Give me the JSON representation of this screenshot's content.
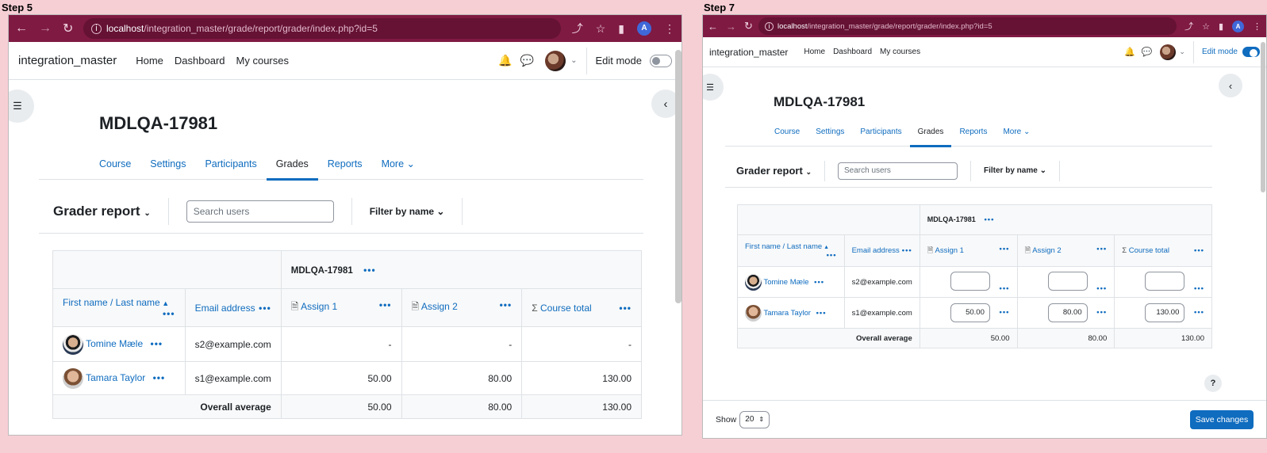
{
  "left": {
    "step_label": "Step 5",
    "url_host": "localhost",
    "url_path": "/integration_master/grade/report/grader/index.php?id=5",
    "account_initial": "A",
    "brand": "integration_master",
    "menu": [
      "Home",
      "Dashboard",
      "My courses"
    ],
    "edit_mode_label": "Edit mode",
    "course_title": "MDLQA-17981",
    "secnav": [
      "Course",
      "Settings",
      "Participants",
      "Grades",
      "Reports",
      "More"
    ],
    "report_title": "Grader report",
    "search_placeholder": "Search users",
    "filter_label": "Filter by name",
    "category_header": "MDLQA-17981",
    "col_name": "First name / Last name",
    "col_email": "Email address",
    "col_assign1": "Assign 1",
    "col_assign2": "Assign 2",
    "col_total": "Course total",
    "rows": [
      {
        "name": "Tomine Mæle",
        "email": "s2@example.com",
        "a1": "-",
        "a2": "-",
        "total": "-"
      },
      {
        "name": "Tamara Taylor",
        "email": "s1@example.com",
        "a1": "50.00",
        "a2": "80.00",
        "total": "130.00"
      }
    ],
    "avg_label": "Overall average",
    "avg": {
      "a1": "50.00",
      "a2": "80.00",
      "total": "130.00"
    }
  },
  "right": {
    "step_label": "Step 7",
    "url_host": "localhost",
    "url_path": "/integration_master/grade/report/grader/index.php?id=5",
    "account_initial": "A",
    "brand": "integration_master",
    "menu": [
      "Home",
      "Dashboard",
      "My courses"
    ],
    "edit_mode_label": "Edit mode",
    "course_title": "MDLQA-17981",
    "secnav": [
      "Course",
      "Settings",
      "Participants",
      "Grades",
      "Reports",
      "More"
    ],
    "report_title": "Grader report",
    "search_placeholder": "Search users",
    "filter_label": "Filter by name",
    "category_header": "MDLQA-17981",
    "col_name": "First name / Last name",
    "col_email": "Email address",
    "col_assign1": "Assign 1",
    "col_assign2": "Assign 2",
    "col_total": "Course total",
    "rows": [
      {
        "name": "Tomine Mæle",
        "email": "s2@example.com",
        "a1": "",
        "a2": "",
        "total": ""
      },
      {
        "name": "Tamara Taylor",
        "email": "s1@example.com",
        "a1": "50.00",
        "a2": "80.00",
        "total": "130.00"
      }
    ],
    "avg_label": "Overall average",
    "avg": {
      "a1": "50.00",
      "a2": "80.00",
      "total": "130.00"
    },
    "show_label": "Show",
    "show_value": "20",
    "save_label": "Save changes",
    "help_glyph": "?"
  },
  "colors": {
    "browser_bar": "#7f1a43",
    "link": "#0f6cbf",
    "background": "#f6cfd5"
  },
  "icons": [
    "back-icon",
    "forward-icon",
    "reload-icon",
    "info-icon",
    "share-icon",
    "star-icon",
    "sidepanel-icon",
    "kebab-icon",
    "bell-icon",
    "chat-icon",
    "chevron-down-icon",
    "index-icon",
    "chevron-left-icon",
    "sort-up-icon",
    "assignment-icon",
    "sigma-icon"
  ]
}
